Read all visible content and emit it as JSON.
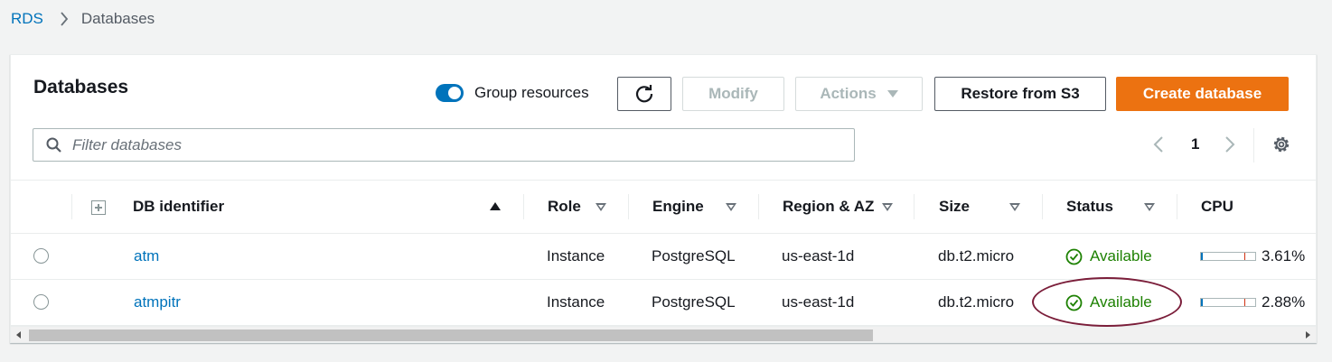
{
  "breadcrumb": {
    "root": "RDS",
    "current": "Databases"
  },
  "panel": {
    "title": "Databases",
    "group_toggle": {
      "label": "Group resources",
      "on": true
    },
    "buttons": {
      "modify": "Modify",
      "actions": "Actions",
      "restore": "Restore from S3",
      "create": "Create database"
    },
    "filter": {
      "placeholder": "Filter databases",
      "value": ""
    },
    "pagination": {
      "page": "1"
    }
  },
  "table": {
    "columns": {
      "db_identifier": "DB identifier",
      "role": "Role",
      "engine": "Engine",
      "region": "Region & AZ",
      "size": "Size",
      "status": "Status",
      "cpu": "CPU"
    },
    "rows": [
      {
        "identifier": "atm",
        "role": "Instance",
        "engine": "PostgreSQL",
        "region": "us-east-1d",
        "size": "db.t2.micro",
        "status": "Available",
        "cpu": "3.61%"
      },
      {
        "identifier": "atmpitr",
        "role": "Instance",
        "engine": "PostgreSQL",
        "region": "us-east-1d",
        "size": "db.t2.micro",
        "status": "Available",
        "cpu": "2.88%"
      }
    ]
  },
  "colors": {
    "link": "#0073bb",
    "primary_button": "#ec7211",
    "status_ok": "#1d8102",
    "annotation": "#7b1e3a"
  }
}
